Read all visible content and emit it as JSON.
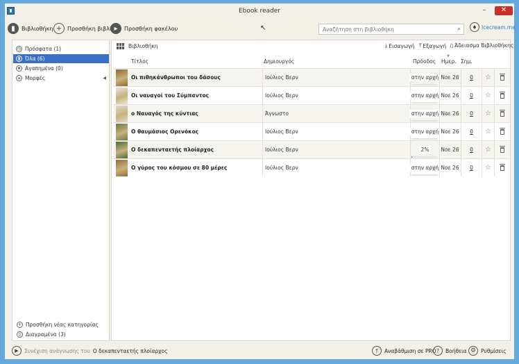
{
  "window": {
    "title": "Ebook reader",
    "min": "–",
    "max": "□",
    "close": "✕"
  },
  "toolbar": {
    "library": "Βιβλιοθήκη",
    "add_book": "Προσθήκη βιβλίου",
    "add_folder": "Προσθήκη φακέλου",
    "search_placeholder": "Αναζήτηση στη βιβλιοθήκη",
    "brand": "Icecream.me"
  },
  "sidebar": {
    "items": [
      {
        "label": "Πρόσφατα (1)",
        "icon": "clock-icon"
      },
      {
        "label": "Όλα (6)",
        "icon": "book-icon"
      },
      {
        "label": "Αγαπημένα (0)",
        "icon": "star-icon"
      },
      {
        "label": "Μορφές",
        "icon": "formats-icon"
      }
    ],
    "add_category": "Προσθήκη νέας κατηγορίας",
    "deleted": "Διαγραμένα (3)"
  },
  "main": {
    "breadcrumb": "Βιβλιοθήκη",
    "import": "Εισαγωγή",
    "export": "Εξαγωγή",
    "clear": "Άδειασμα Βιβλιοθήκης",
    "columns": {
      "title": "Τίτλος",
      "author": "Δημιουργός",
      "progress": "Πρόοδος",
      "date": "Ημερ.",
      "notes": "Σημ."
    }
  },
  "books": [
    {
      "title": "Οι πιθηκάνθρωποι του δάσους",
      "author": "Ιούλιος Βερν",
      "progress": "στην αρχή",
      "progress_value": 0,
      "date": "Νοε 26",
      "notes": "0",
      "cover": "#8a6a3a"
    },
    {
      "title": "Οι ναυαγοί του Σύμπαντος",
      "author": "Ιούλιος Βερν",
      "progress": "στην αρχή",
      "progress_value": 0,
      "date": "Νοε 26",
      "notes": "0",
      "cover": "#e8e6de"
    },
    {
      "title": "ο Ναυαγός της κύντιας",
      "author": "Άγνωστο",
      "progress": "στην αρχή",
      "progress_value": 0,
      "date": "Νοε 26",
      "notes": "0",
      "cover": "#dcdad2"
    },
    {
      "title": "Ο θαυμάσιος Ορενόκος",
      "author": "Ιούλιος Βερν",
      "progress": "στην αρχή",
      "progress_value": 0,
      "date": "Νοε 26",
      "notes": "0",
      "cover": "#6a7a4a"
    },
    {
      "title": "Ο δεκαπενταετής πλοίαρχος",
      "author": "Ιούλιος Βερν",
      "progress": "2%",
      "progress_value": 0.02,
      "date": "Νοε 26",
      "notes": "0",
      "cover": "#4a6a3a"
    },
    {
      "title": "Ο γύρος του κόσμου σε 80 μέρες",
      "author": "Ιούλιος Βερν",
      "progress": "στην αρχή",
      "progress_value": 0,
      "date": "Νοε 26",
      "notes": "0",
      "cover": "#9a6a3a"
    }
  ],
  "status": {
    "continue": "Συνέχιση ανάγνωσης του",
    "current_book": "Ο δεκαπενταετής πλοίαρχος",
    "upgrade": "Αναβάθμιση σε PRO",
    "help": "Βοήθεια",
    "settings": "Ρυθμίσεις"
  }
}
